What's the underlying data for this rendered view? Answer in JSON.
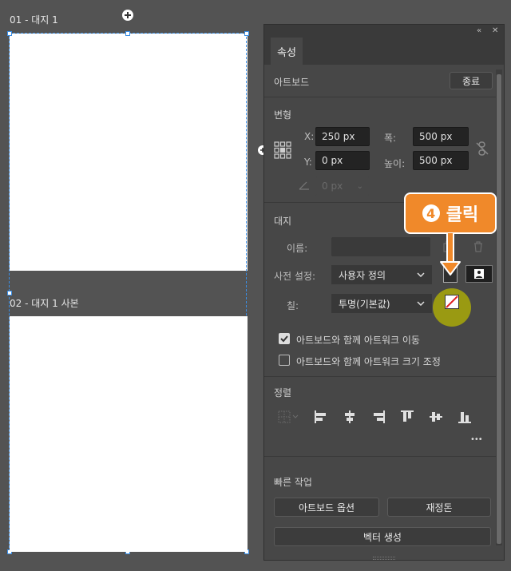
{
  "canvas": {
    "artboard1_label": "01 - 대지 1",
    "artboard2_label": "02 - 대지 1 사본"
  },
  "panel": {
    "collapse_glyph": "«",
    "close_glyph": "✕",
    "tab_label": "속성",
    "artboard_section": {
      "title": "아트보드",
      "done_button": "종료"
    },
    "transform": {
      "title": "변형",
      "x_label": "X:",
      "x_value": "250 px",
      "y_label": "Y:",
      "y_value": "0 px",
      "w_label": "폭:",
      "w_value": "500 px",
      "h_label": "높이:",
      "h_value": "500 px",
      "angle_value": "0 px"
    },
    "artboard_props": {
      "title": "대지",
      "name_label": "이름:",
      "name_value": "",
      "preset_label": "사전 설정:",
      "preset_value": "사용자 정의",
      "fill_label": "칠:",
      "fill_value": "투명(기본값)",
      "move_artwork_label": "아트보드와 함께 아트워크 이동",
      "move_artwork_checked": true,
      "resize_artwork_label": "아트보드와 함께 아트워크 크기 조정",
      "resize_artwork_checked": false
    },
    "align": {
      "title": "정렬",
      "more_glyph": "•••"
    },
    "quick_actions": {
      "title": "빠른 작업",
      "artboard_options_button": "아트보드 옵션",
      "rearrange_button": "재정돈",
      "vector_generate_button": "벡터 생성"
    }
  },
  "callout": {
    "number": "4",
    "text": "클릭",
    "color": "#f0892a",
    "highlight_color": "#9a9a12"
  },
  "colors": {
    "background": "#535353",
    "panel": "#474747",
    "selection": "#3a8ee6"
  }
}
